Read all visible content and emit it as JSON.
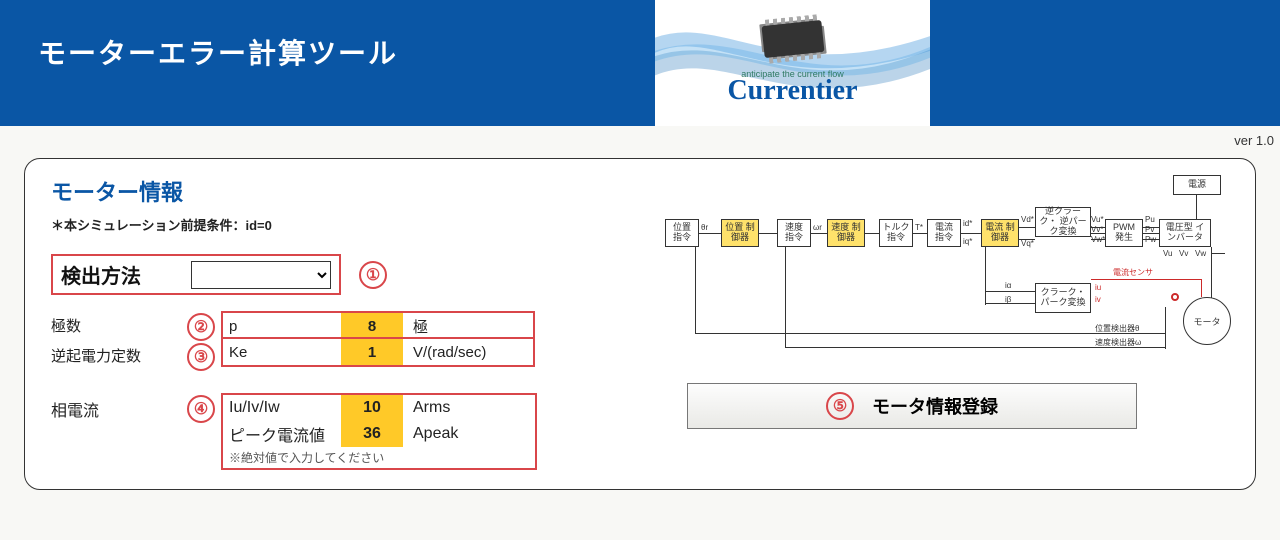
{
  "header": {
    "title": "モーターエラー計算ツール",
    "logo_tagline": "anticipate the current flow",
    "logo_brand": "Currentier",
    "version": "ver 1.0"
  },
  "section": {
    "title": "モーター情報",
    "precondition": "＊本シミュレーション前提条件：id=0"
  },
  "detect": {
    "label": "検出方法",
    "value": "",
    "callout": "①"
  },
  "params": {
    "poles": {
      "row_label": "極数",
      "callout": "②",
      "symbol": "p",
      "value": "8",
      "unit": "極"
    },
    "ke": {
      "row_label": "逆起電力定数",
      "callout": "③",
      "symbol": "Ke",
      "value": "1",
      "unit": "V/(rad/sec)"
    },
    "phase": {
      "row_label": "相電流",
      "callout": "④",
      "line1": {
        "symbol": "Iu/Iv/Iw",
        "value": "10",
        "unit": "Arms"
      },
      "line2": {
        "symbol": "ピーク電流値",
        "value": "36",
        "unit": "Apeak"
      },
      "note": "※絶対値で入力してください"
    }
  },
  "diagram": {
    "b_power": "電源",
    "b_poscmd": "位置\n指令",
    "b_posctl": "位置\n制御器",
    "b_velcmd": "速度\n指令",
    "b_velctl": "速度\n制御器",
    "b_trqcmd": "トルク\n指令",
    "b_curcmd": "電流\n指令",
    "b_curctl": "電流\n制御器",
    "b_invclk": "逆クラーク・\n逆パーク変換",
    "b_pwm": "PWM\n発生",
    "b_inverter": "電圧型\nインバータ",
    "b_clk": "クラーク・\nパーク変換",
    "b_motor": "モータ",
    "t_posdet": "位置検出器θ",
    "t_veldet": "速度検出器ω",
    "t_cursense": "電流センサ",
    "s_theta": "θr",
    "s_omega": "ωr",
    "s_T": "T*",
    "s_id": "id*",
    "s_iq": "iq*",
    "s_vd": "Vd*",
    "s_vq": "Vq*",
    "s_vu": "Vu*",
    "s_vv": "Vv*",
    "s_vw": "Vw*",
    "s_pu": "Pu",
    "s_pv": "Pv",
    "s_pw": "Pw",
    "s_Vu": "Vu",
    "s_Vv": "Vv",
    "s_Vw": "Vw",
    "s_iu": "iu",
    "s_iv": "iv",
    "s_ia": "iα",
    "s_ib": "iβ"
  },
  "register": {
    "callout": "⑤",
    "label": "モータ情報登録"
  }
}
